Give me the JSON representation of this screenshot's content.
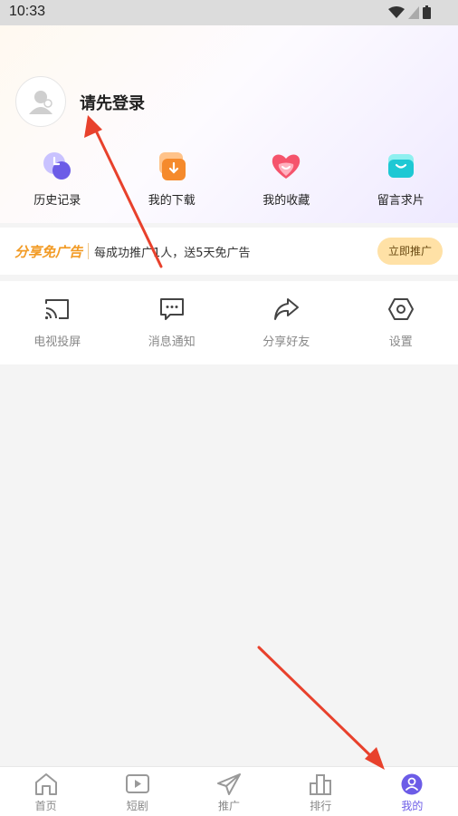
{
  "status_bar": {
    "time": "10:33"
  },
  "profile": {
    "login_prompt": "请先登录"
  },
  "quick_actions": [
    {
      "label": "历史记录",
      "icon": "history-icon"
    },
    {
      "label": "我的下载",
      "icon": "download-icon"
    },
    {
      "label": "我的收藏",
      "icon": "favorites-icon"
    },
    {
      "label": "留言求片",
      "icon": "message-request-icon"
    }
  ],
  "promo": {
    "title": "分享免广告",
    "description": "每成功推广1人，送5天免广告",
    "button": "立即推广"
  },
  "tools": [
    {
      "label": "电视投屏",
      "icon": "cast-icon"
    },
    {
      "label": "消息通知",
      "icon": "message-icon"
    },
    {
      "label": "分享好友",
      "icon": "share-icon"
    },
    {
      "label": "设置",
      "icon": "settings-icon"
    }
  ],
  "tabbar": [
    {
      "label": "首页",
      "icon": "home-icon",
      "active": false
    },
    {
      "label": "短剧",
      "icon": "play-icon",
      "active": false
    },
    {
      "label": "推广",
      "icon": "send-icon",
      "active": false
    },
    {
      "label": "排行",
      "icon": "ranking-icon",
      "active": false
    },
    {
      "label": "我的",
      "icon": "profile-icon",
      "active": true
    }
  ],
  "colors": {
    "accent": "#6c5ce7",
    "promo": "#f29b25",
    "annotation": "#e8412c"
  }
}
